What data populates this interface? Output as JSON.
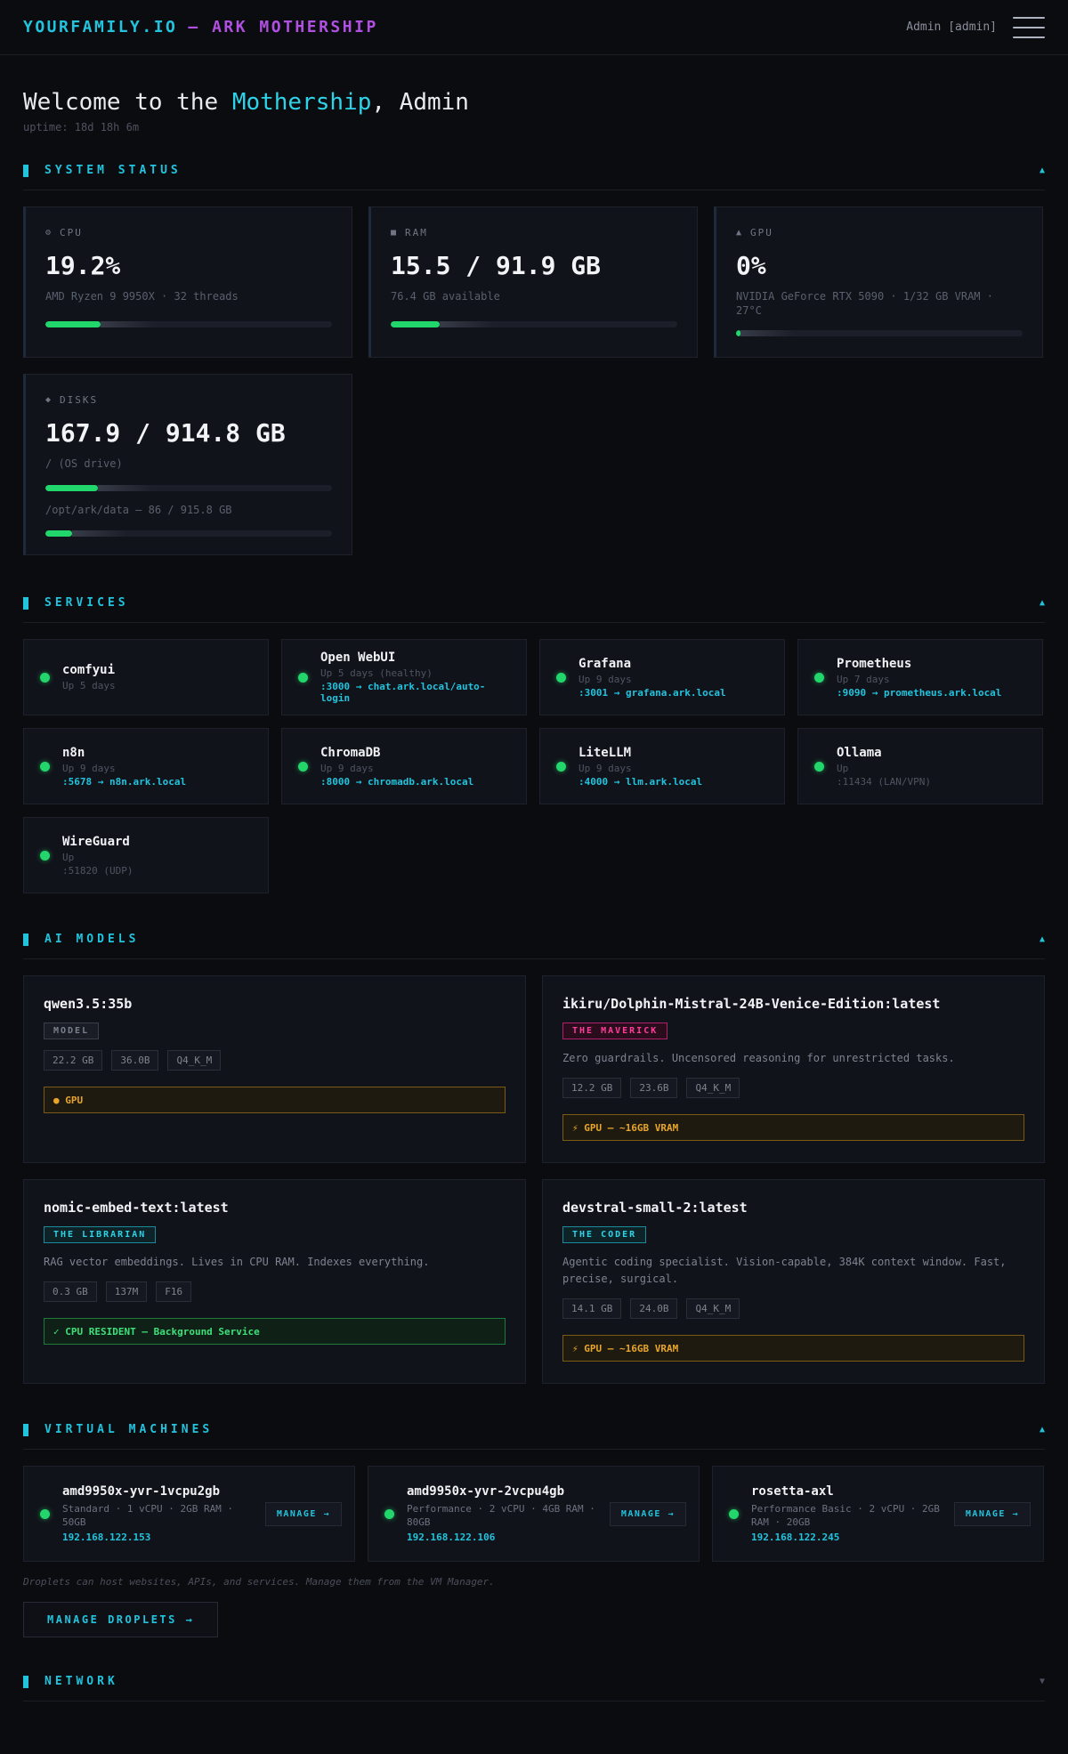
{
  "header": {
    "brand_primary": "YOURFAMILY.IO",
    "brand_secondary": "— ARK MOTHERSHIP",
    "user_label": "Admin [admin]"
  },
  "welcome": {
    "prefix": "Welcome to the ",
    "highlight": "Mothership",
    "suffix": ", Admin",
    "uptime": "uptime: 18d 18h 6m"
  },
  "system_status": {
    "title": "SYSTEM STATUS",
    "cpu": {
      "label": "CPU",
      "icon": "gear-icon",
      "value": "19.2%",
      "sub": "AMD Ryzen 9 9950X · 32 threads",
      "percent": 19.2
    },
    "ram": {
      "label": "RAM",
      "icon": "square-icon",
      "value": "15.5 / 91.9 GB",
      "sub": "76.4 GB available",
      "percent": 17
    },
    "gpu": {
      "label": "GPU",
      "icon": "triangle-icon",
      "value": "0%",
      "sub": "NVIDIA GeForce RTX 5090 · 1/32 GB VRAM · 27°C",
      "percent": 0
    },
    "disks": {
      "label": "DISKS",
      "icon": "diamond-icon",
      "value": "167.9 / 914.8 GB",
      "sub": "/ (OS drive)",
      "percent": 18.4,
      "secondary": "/opt/ark/data — 86 / 915.8 GB",
      "secondary_percent": 9.4
    }
  },
  "services": {
    "title": "SERVICES",
    "items": [
      {
        "name": "comfyui",
        "status": "Up 5 days",
        "link": "",
        "port": ""
      },
      {
        "name": "Open WebUI",
        "status": "Up 5 days (healthy)",
        "link": ":3000 → chat.ark.local/auto-login",
        "port": ""
      },
      {
        "name": "Grafana",
        "status": "Up 9 days",
        "link": ":3001 → grafana.ark.local",
        "port": ""
      },
      {
        "name": "Prometheus",
        "status": "Up 7 days",
        "link": ":9090 → prometheus.ark.local",
        "port": ""
      },
      {
        "name": "n8n",
        "status": "Up 9 days",
        "link": ":5678 → n8n.ark.local",
        "port": ""
      },
      {
        "name": "ChromaDB",
        "status": "Up 9 days",
        "link": ":8000 → chromadb.ark.local",
        "port": ""
      },
      {
        "name": "LiteLLM",
        "status": "Up 9 days",
        "link": ":4000 → llm.ark.local",
        "port": ""
      },
      {
        "name": "Ollama",
        "status": "Up",
        "link": "",
        "port": ":11434 (LAN/VPN)"
      },
      {
        "name": "WireGuard",
        "status": "Up",
        "link": "",
        "port": ":51820 (UDP)"
      }
    ]
  },
  "models": {
    "title": "AI MODELS",
    "items": [
      {
        "name": "qwen3.5:35b",
        "badge": "MODEL",
        "desc": "",
        "tags": [
          "22.2 GB",
          "36.0B",
          "Q4_K_M"
        ],
        "bar": "● GPU"
      },
      {
        "name": "ikiru/Dolphin-Mistral-24B-Venice-Edition:latest",
        "badge": "THE MAVERICK",
        "desc": "Zero guardrails. Uncensored reasoning for unrestricted tasks.",
        "tags": [
          "12.2 GB",
          "23.6B",
          "Q4_K_M"
        ],
        "bar": "⚡ GPU — ~16GB VRAM"
      },
      {
        "name": "nomic-embed-text:latest",
        "badge": "THE LIBRARIAN",
        "desc": "RAG vector embeddings. Lives in CPU RAM. Indexes everything.",
        "tags": [
          "0.3 GB",
          "137M",
          "F16"
        ],
        "bar": "✓ CPU RESIDENT — Background Service"
      },
      {
        "name": "devstral-small-2:latest",
        "badge": "THE CODER",
        "desc": "Agentic coding specialist. Vision-capable, 384K context window. Fast, precise, surgical.",
        "tags": [
          "14.1 GB",
          "24.0B",
          "Q4_K_M"
        ],
        "bar": "⚡ GPU — ~16GB VRAM"
      }
    ]
  },
  "vms": {
    "title": "VIRTUAL MACHINES",
    "manage_label": "MANAGE →",
    "items": [
      {
        "name": "amd9950x-yvr-1vcpu2gb",
        "spec": "Standard · 1 vCPU · 2GB RAM · 50GB",
        "ip": "192.168.122.153"
      },
      {
        "name": "amd9950x-yvr-2vcpu4gb",
        "spec": "Performance · 2 vCPU · 4GB RAM · 80GB",
        "ip": "192.168.122.106"
      },
      {
        "name": "rosetta-axl",
        "spec": "Performance Basic · 2 vCPU · 2GB RAM · 20GB",
        "ip": "192.168.122.245"
      }
    ],
    "note": "Droplets can host websites, APIs, and services. Manage them from the VM Manager.",
    "droplets_button": "MANAGE DROPLETS →"
  },
  "network": {
    "title": "NETWORK"
  },
  "icons": {
    "expanded": "▲",
    "collapsed": "▼"
  },
  "colors": {
    "accent": "#22c3dd",
    "brand_secondary": "#b050e0",
    "ok": "#22d66b",
    "warn": "#e8a52a",
    "pink": "#ff3d9a"
  }
}
